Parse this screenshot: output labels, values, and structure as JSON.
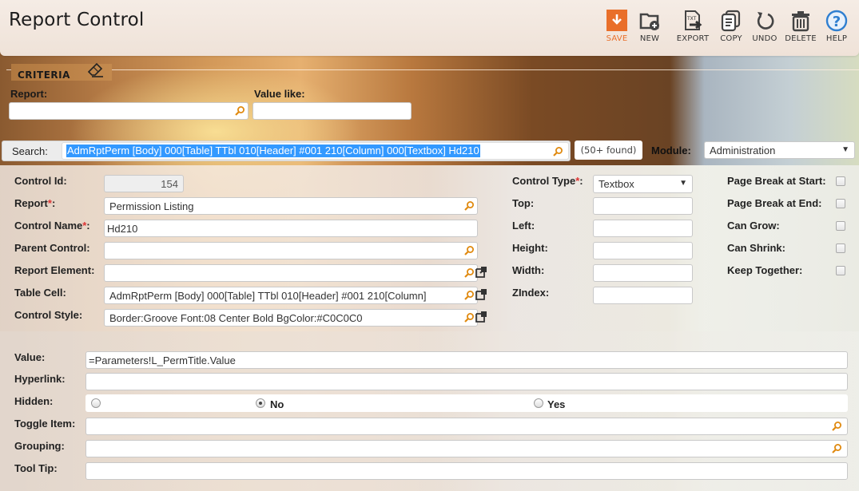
{
  "header": {
    "title": "Report Control",
    "toolbar": [
      {
        "id": "save",
        "label": "SAVE",
        "icon": "save-icon"
      },
      {
        "id": "new",
        "label": "NEW",
        "icon": "new-folder-icon"
      },
      {
        "id": "export",
        "label": "EXPORT",
        "icon": "export-txt-icon"
      },
      {
        "id": "copy",
        "label": "COPY",
        "icon": "copy-icon"
      },
      {
        "id": "undo",
        "label": "UNDO",
        "icon": "undo-icon"
      },
      {
        "id": "delete",
        "label": "DELETE",
        "icon": "trash-icon"
      },
      {
        "id": "help",
        "label": "HELP",
        "icon": "help-icon"
      }
    ],
    "accent_color": "#e96f2a",
    "help_color": "#2f7fd0"
  },
  "criteria": {
    "legend": "CRITERIA",
    "report_label": "Report:",
    "report_value": "",
    "value_like_label": "Value like:",
    "value_like_value": ""
  },
  "search": {
    "label": "Search:",
    "value": "AdmRptPerm [Body] 000[Table] TTbl 010[Header] #001 210[Column] 000[Textbox] Hd210",
    "found": "(50+ found)",
    "module_label": "Module:",
    "module_value": "Administration"
  },
  "form": {
    "control_id": {
      "label": "Control Id:",
      "value": "154"
    },
    "report": {
      "label": "Report",
      "value": "Permission Listing"
    },
    "control_name": {
      "label": "Control Name",
      "value": "Hd210"
    },
    "parent_control": {
      "label": "Parent Control:",
      "value": ""
    },
    "report_element": {
      "label": "Report Element:",
      "value": ""
    },
    "table_cell": {
      "label": "Table Cell:",
      "value": "AdmRptPerm [Body] 000[Table] TTbl 010[Header] #001 210[Column]"
    },
    "control_style": {
      "label": "Control Style:",
      "value": "Border:Groove Font:08 Center Bold BgColor:#C0C0C0"
    },
    "control_type": {
      "label": "Control Type",
      "value": "Textbox"
    },
    "top": {
      "label": "Top:",
      "value": ""
    },
    "left": {
      "label": "Left:",
      "value": ""
    },
    "height": {
      "label": "Height:",
      "value": ""
    },
    "width": {
      "label": "Width:",
      "value": ""
    },
    "zindex": {
      "label": "ZIndex:",
      "value": ""
    },
    "required_mark": "*",
    "colon": ":",
    "checkboxes": [
      {
        "label": "Page Break at Start:",
        "checked": false
      },
      {
        "label": "Page Break at End:",
        "checked": false
      },
      {
        "label": "Can Grow:",
        "checked": false
      },
      {
        "label": "Can Shrink:",
        "checked": false
      },
      {
        "label": "Keep Together:",
        "checked": false
      }
    ],
    "value": {
      "label": "Value:",
      "value": "=Parameters!L_PermTitle.Value"
    },
    "hyperlink": {
      "label": "Hyperlink:",
      "value": ""
    },
    "hidden": {
      "label": "Hidden:",
      "options": [
        "",
        "No",
        "Yes"
      ],
      "selected": "No"
    },
    "toggle_item": {
      "label": "Toggle Item:",
      "value": ""
    },
    "grouping": {
      "label": "Grouping:",
      "value": ""
    },
    "tool_tip": {
      "label": "Tool Tip:",
      "value": ""
    }
  }
}
